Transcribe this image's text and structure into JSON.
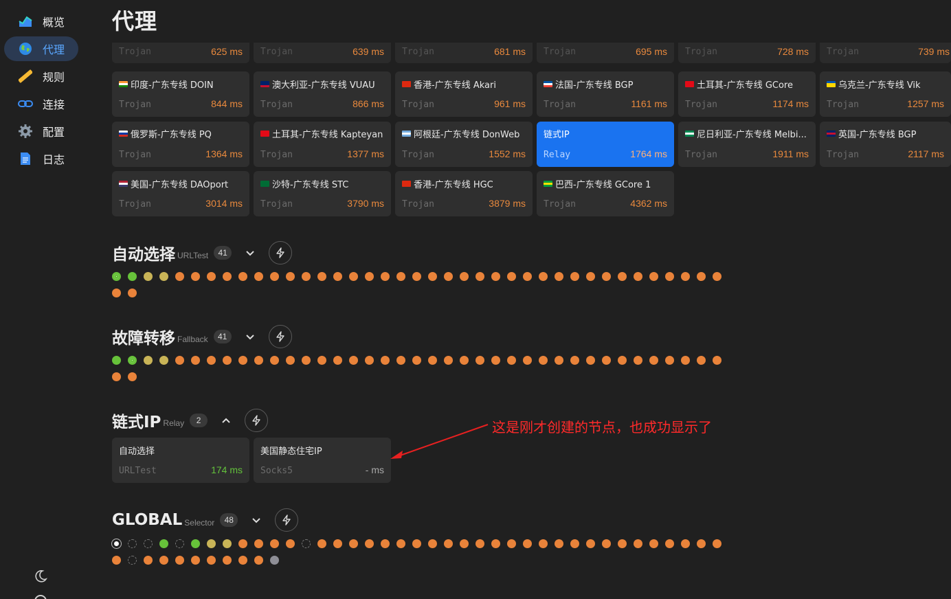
{
  "sidebar": {
    "items": [
      {
        "label": "概览",
        "icon": "chart-area-icon"
      },
      {
        "label": "代理",
        "icon": "globe-icon",
        "active": true
      },
      {
        "label": "规则",
        "icon": "ruler-icon"
      },
      {
        "label": "连接",
        "icon": "link-icon"
      },
      {
        "label": "配置",
        "icon": "gear-icon"
      },
      {
        "label": "日志",
        "icon": "document-icon"
      }
    ]
  },
  "page": {
    "title": "代理"
  },
  "top_row": [
    {
      "type": "Trojan",
      "latency": "625 ms"
    },
    {
      "type": "Trojan",
      "latency": "639 ms"
    },
    {
      "type": "Trojan",
      "latency": "681 ms"
    },
    {
      "type": "Trojan",
      "latency": "695 ms"
    },
    {
      "type": "Trojan",
      "latency": "728 ms"
    },
    {
      "type": "Trojan",
      "latency": "739 ms"
    }
  ],
  "cards": [
    {
      "name": "印度-广东专线 DOIN",
      "flag": "in",
      "type": "Trojan",
      "latency": "844 ms"
    },
    {
      "name": "澳大利亚-广东专线 VUAU",
      "flag": "au",
      "type": "Trojan",
      "latency": "866 ms"
    },
    {
      "name": "香港-广东专线 Akari",
      "flag": "hk",
      "type": "Trojan",
      "latency": "961 ms"
    },
    {
      "name": "法国-广东专线 BGP",
      "flag": "fr",
      "type": "Trojan",
      "latency": "1161 ms"
    },
    {
      "name": "土耳其-广东专线 GCore",
      "flag": "tr",
      "type": "Trojan",
      "latency": "1174 ms"
    },
    {
      "name": "乌克兰-广东专线 Vik",
      "flag": "ua",
      "type": "Trojan",
      "latency": "1257 ms"
    },
    {
      "name": "俄罗斯-广东专线 PQ",
      "flag": "ru",
      "type": "Trojan",
      "latency": "1364 ms"
    },
    {
      "name": "土耳其-广东专线 Kapteyan",
      "flag": "tr",
      "type": "Trojan",
      "latency": "1377 ms"
    },
    {
      "name": "阿根廷-广东专线 DonWeb",
      "flag": "ar",
      "type": "Trojan",
      "latency": "1552 ms"
    },
    {
      "name": "链式IP",
      "flag": "",
      "type": "Relay",
      "latency": "1764 ms",
      "selected": true
    },
    {
      "name": "尼日利亚-广东专线 Melbi...",
      "flag": "ng",
      "type": "Trojan",
      "latency": "1911 ms"
    },
    {
      "name": "英国-广东专线 BGP",
      "flag": "gb",
      "type": "Trojan",
      "latency": "2117 ms"
    },
    {
      "name": "美国-广东专线 DAOport",
      "flag": "us",
      "type": "Trojan",
      "latency": "3014 ms"
    },
    {
      "name": "沙特-广东专线 STC",
      "flag": "sa",
      "type": "Trojan",
      "latency": "3790 ms"
    },
    {
      "name": "香港-广东专线 HGC",
      "flag": "hk",
      "type": "Trojan",
      "latency": "3879 ms"
    },
    {
      "name": "巴西-广东专线 GCore 1",
      "flag": "br",
      "type": "Trojan",
      "latency": "4362 ms"
    }
  ],
  "groups": [
    {
      "name": "自动选择",
      "type": "URLTest",
      "count": "41",
      "expanded": false,
      "dots": [
        "sel-green",
        "green",
        "yellow",
        "yellow",
        "orange",
        "orange",
        "orange",
        "orange",
        "orange",
        "orange",
        "orange",
        "orange",
        "orange",
        "orange",
        "orange",
        "orange",
        "orange",
        "orange",
        "orange",
        "orange",
        "orange",
        "orange",
        "orange",
        "orange",
        "orange",
        "orange",
        "orange",
        "orange",
        "orange",
        "orange",
        "orange",
        "orange",
        "orange",
        "orange",
        "orange",
        "orange",
        "orange",
        "orange",
        "orange",
        "orange",
        "orange"
      ]
    },
    {
      "name": "故障转移",
      "type": "Fallback",
      "count": "41",
      "expanded": false,
      "dots": [
        "green",
        "sel-green",
        "yellow",
        "yellow",
        "orange",
        "orange",
        "orange",
        "orange",
        "orange",
        "orange",
        "orange",
        "orange",
        "orange",
        "orange",
        "orange",
        "orange",
        "orange",
        "orange",
        "orange",
        "orange",
        "orange",
        "orange",
        "orange",
        "orange",
        "orange",
        "orange",
        "orange",
        "orange",
        "orange",
        "orange",
        "orange",
        "orange",
        "orange",
        "orange",
        "orange",
        "orange",
        "orange",
        "orange",
        "orange",
        "orange",
        "orange"
      ]
    },
    {
      "name": "链式IP",
      "type": "Relay",
      "count": "2",
      "expanded": true
    },
    {
      "name": "GLOBAL",
      "type": "Selector",
      "count": "48",
      "expanded": false,
      "dots": [
        "sel-white",
        "empty",
        "empty",
        "green",
        "empty",
        "green",
        "yellow",
        "yellow",
        "orange",
        "orange",
        "orange",
        "orange",
        "empty",
        "orange",
        "orange",
        "orange",
        "orange",
        "orange",
        "orange",
        "orange",
        "orange",
        "orange",
        "orange",
        "orange",
        "orange",
        "orange",
        "orange",
        "orange",
        "orange",
        "orange",
        "orange",
        "orange",
        "orange",
        "orange",
        "orange",
        "orange",
        "orange",
        "orange",
        "orange",
        "orange",
        "empty",
        "orange",
        "orange",
        "orange",
        "orange",
        "orange",
        "orange",
        "orange",
        "orange",
        "gray"
      ]
    }
  ],
  "relay_cards": [
    {
      "name": "自动选择",
      "type": "URLTest",
      "latency": "174 ms",
      "good": true
    },
    {
      "name": "美国静态住宅IP",
      "type": "Socks5",
      "latency": "- ms",
      "none": true
    }
  ],
  "annotation": {
    "text": "这是刚才创建的节点，也成功显示了"
  },
  "colors": {
    "orange": "#e9833a",
    "green": "#67c23a",
    "yellow": "#c9b457",
    "blue": "#1a73f0",
    "annotation": "#ff2a2a"
  }
}
